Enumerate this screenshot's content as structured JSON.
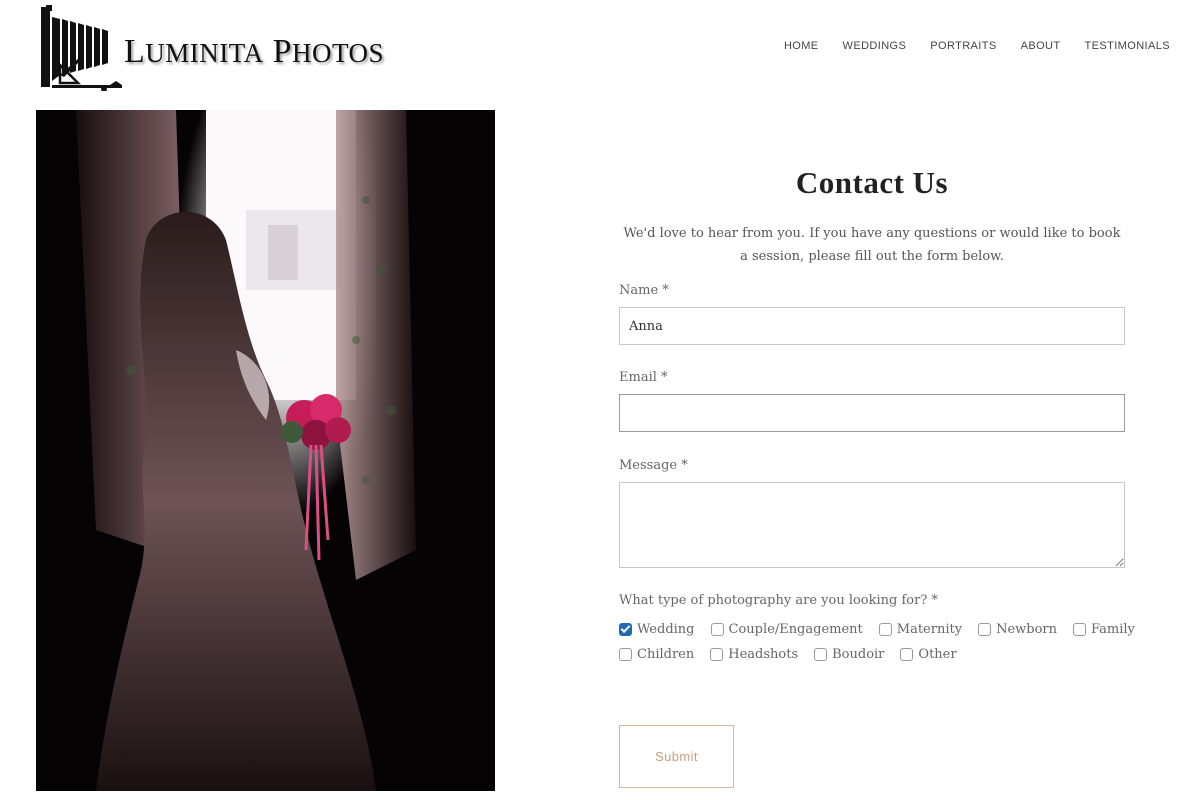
{
  "brand": {
    "name_first_initial": "L",
    "name_first_rest": "UMINITA",
    "name_second_initial": "P",
    "name_second_rest": "HOTOS",
    "logo_icon": "camera-bellows-icon"
  },
  "nav": {
    "items": [
      "HOME",
      "WEDDINGS",
      "PORTRAITS",
      "ABOUT",
      "TESTIMONIALS"
    ]
  },
  "form": {
    "title": "Contact Us",
    "intro": "We'd love to hear from you. If you have any questions or would like to book a session, please fill out the form below.",
    "name_label": "Name *",
    "name_value": "Anna",
    "email_label": "Email *",
    "email_value": "",
    "message_label": "Message *",
    "message_value": "",
    "type_question": "What type of photography are you looking for? *",
    "options_row1": [
      {
        "label": "Wedding",
        "checked": true
      },
      {
        "label": "Couple/Engagement",
        "checked": false
      },
      {
        "label": "Maternity",
        "checked": false
      },
      {
        "label": "Newborn",
        "checked": false
      },
      {
        "label": "Family",
        "checked": false
      }
    ],
    "options_row2": [
      {
        "label": "Children",
        "checked": false
      },
      {
        "label": "Headshots",
        "checked": false
      },
      {
        "label": "Boudoir",
        "checked": false
      },
      {
        "label": "Other",
        "checked": false
      }
    ],
    "submit_label": "Submit"
  },
  "colors": {
    "checkbox_checked": "#1e6bb8",
    "submit_border": "#d8b79c",
    "submit_text": "#c9a07f"
  }
}
